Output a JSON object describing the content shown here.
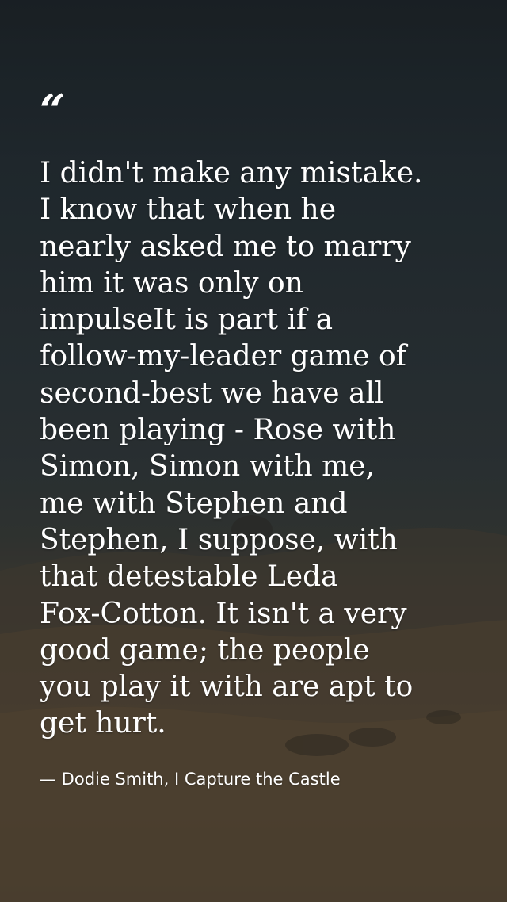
{
  "background": {
    "description_icon": "landscape-background",
    "sky_color": "#232b30",
    "field_color": "#5a4d3d"
  },
  "quote": {
    "mark": "“",
    "text": "I didn't make any mistake.\nI know that when he\nnearly asked me to marry\nhim it was only on\nimpulseIt is part if a\nfollow-my-leader game of\nsecond-best we have all\nbeen playing - Rose with\nSimon, Simon with me,\nme with Stephen and\nStephen, I suppose, with\nthat detestable Leda\nFox-Cotton. It isn't a very\ngood game; the people\nyou play it with are apt to\nget hurt.",
    "attribution": "— Dodie Smith, I Capture the Castle"
  }
}
